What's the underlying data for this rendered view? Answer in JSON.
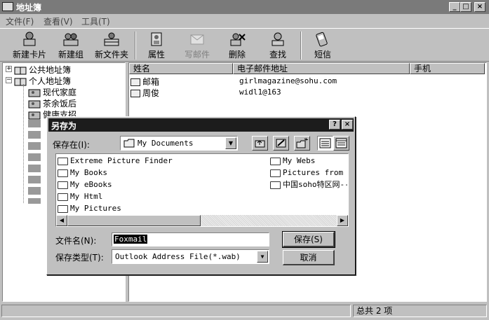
{
  "window": {
    "title": "地址簿"
  },
  "menu": [
    "文件(F)",
    "查看(V)",
    "工具(T)"
  ],
  "toolbar": [
    {
      "label": "新建卡片",
      "icon": "new-card-icon"
    },
    {
      "label": "新建组",
      "icon": "new-group-icon"
    },
    {
      "label": "新文件夹",
      "icon": "new-folder-icon"
    },
    {
      "label": "属性",
      "icon": "properties-icon"
    },
    {
      "label": "写邮件",
      "icon": "write-mail-icon"
    },
    {
      "label": "删除",
      "icon": "delete-icon"
    },
    {
      "label": "查找",
      "icon": "find-icon"
    },
    {
      "label": "短信",
      "icon": "sms-icon"
    }
  ],
  "tree": {
    "public": "公共地址簿",
    "personal": "个人地址簿",
    "children": [
      "现代家庭",
      "茶余饭后",
      "健康支招"
    ]
  },
  "list": {
    "columns": [
      "姓名",
      "电子邮件地址",
      "手机"
    ],
    "rows": [
      {
        "name": "邮箱",
        "email": "girlmagazine@sohu.com"
      },
      {
        "name": "周俊",
        "email": "widl1@163"
      }
    ]
  },
  "status": {
    "total": "总共 2 项"
  },
  "dialog": {
    "title": "另存为",
    "save_in_label": "保存在(I):",
    "save_in_value": "My Documents",
    "files_col1": [
      "Extreme Picture Finder",
      "My Books",
      "My eBooks",
      "My Html",
      "My Pictures"
    ],
    "files_col2": [
      "My Webs",
      "Pictures from We",
      "中国soho特区网--"
    ],
    "filename_label": "文件名(N):",
    "filename_value": "Foxmail",
    "filetype_label": "保存类型(T):",
    "filetype_value": "Outlook Address File(*.wab)",
    "save_button": "保存(S)",
    "cancel_button": "取消"
  }
}
